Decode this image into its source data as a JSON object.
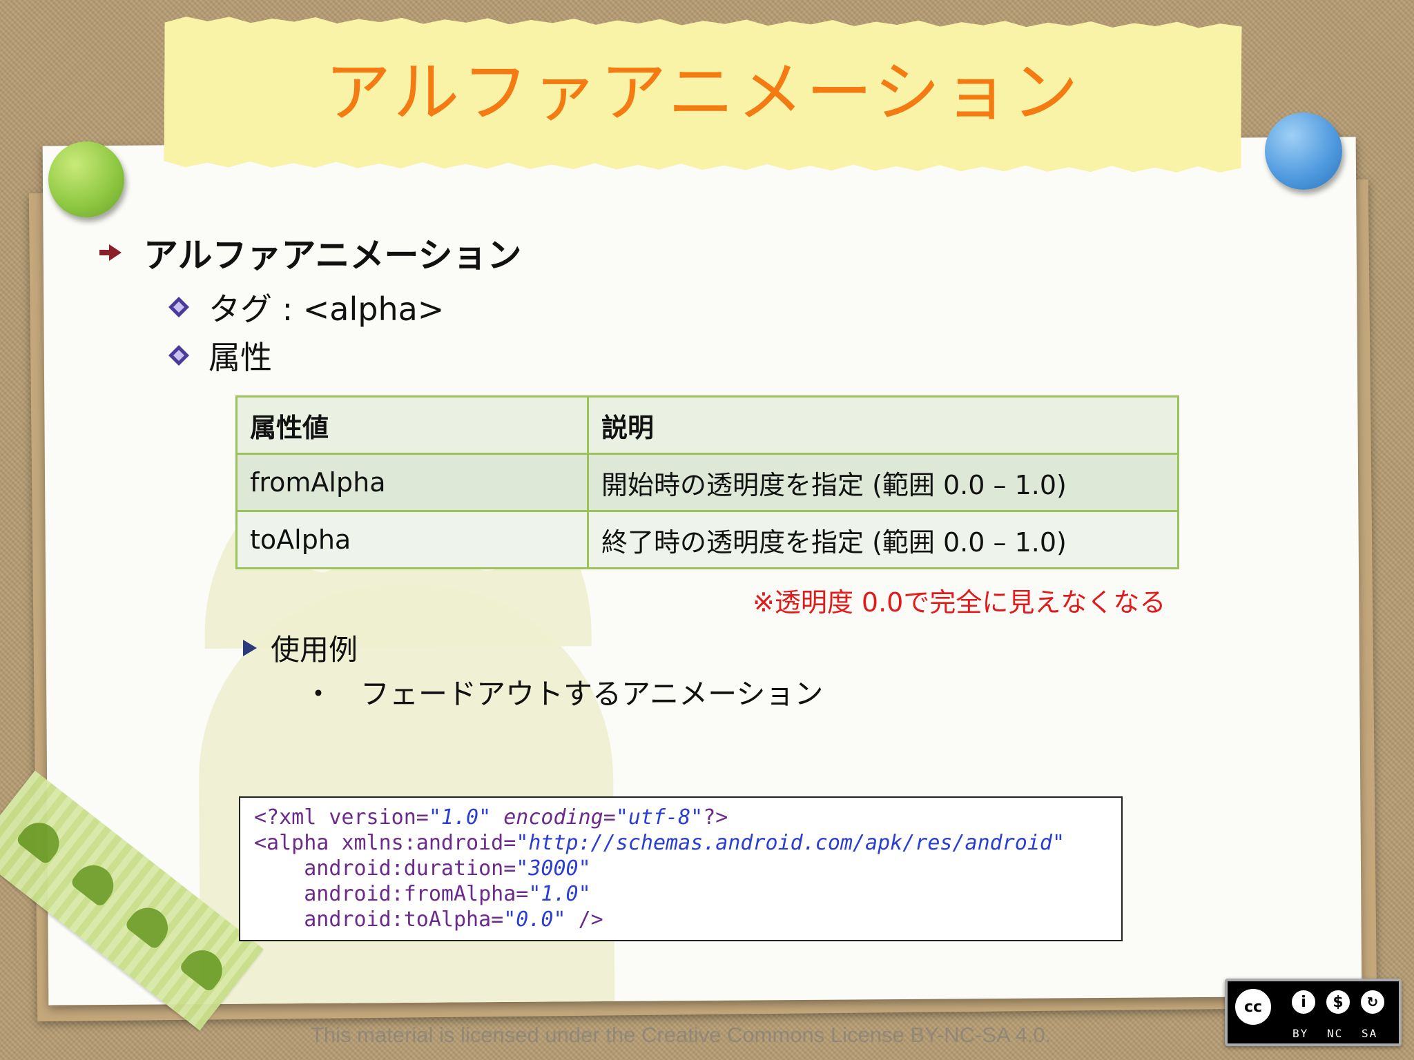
{
  "slide": {
    "title": "アルファアニメーション",
    "heading": "アルファアニメーション",
    "tag_line": "タグ : <alpha>",
    "attributes_label": "属性",
    "table": {
      "headers": [
        "属性値",
        "説明"
      ],
      "rows": [
        [
          "fromAlpha",
          "開始時の透明度を指定 (範囲 0.0 – 1.0)"
        ],
        [
          "toAlpha",
          "終了時の透明度を指定 (範囲 0.0 – 1.0)"
        ]
      ]
    },
    "note": "※透明度 0.0で完全に見えなくなる",
    "usage_label": "使用例",
    "usage_bullet": "・",
    "usage_item": "フェードアウトするアニメーション",
    "code_lines": [
      "<?xml version=\"1.0\" encoding=\"utf-8\"?>",
      "<alpha xmlns:android=\"http://schemas.android.com/apk/res/android\"",
      "    android:duration=\"3000\"",
      "    android:fromAlpha=\"1.0\"",
      "    android:toAlpha=\"0.0\" />"
    ],
    "footer": "This material is licensed under the Creative Commons License BY-NC-SA 4.0.",
    "cc_badge": {
      "labels": [
        "BY",
        "NC",
        "SA"
      ],
      "icons": [
        "cc-icon",
        "by-icon",
        "nc-icon",
        "sa-icon"
      ]
    }
  },
  "colors": {
    "title": "#f47b12",
    "note": "#e01b1b",
    "table_border": "#9bc35a",
    "pin_green": "#8cc63f",
    "pin_blue": "#4c97dd"
  }
}
